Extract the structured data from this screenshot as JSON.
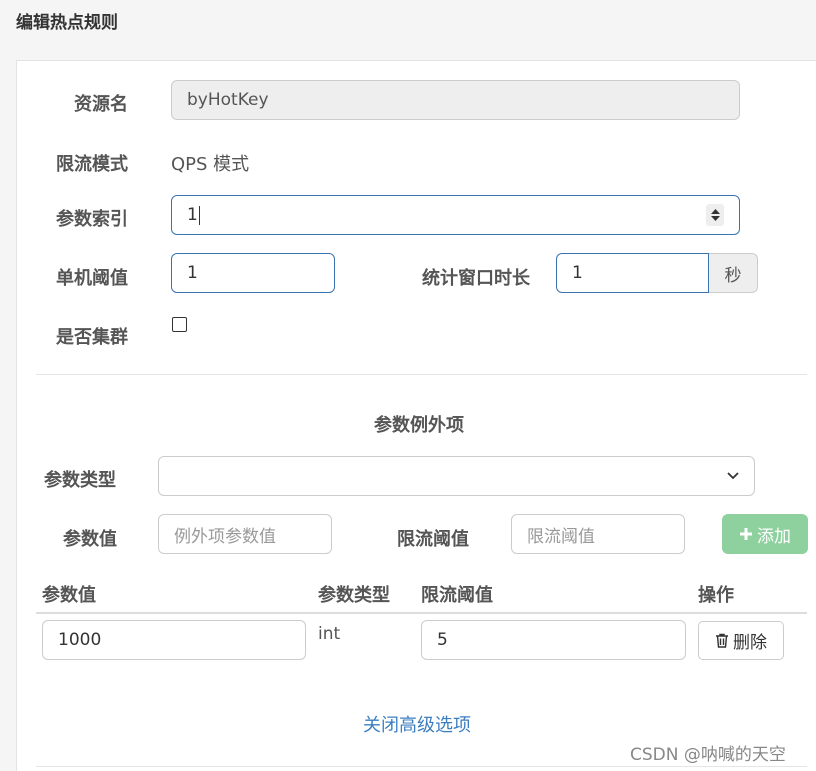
{
  "dialog": {
    "title": "编辑热点规则"
  },
  "form": {
    "resource_label": "资源名",
    "resource_value": "byHotKey",
    "mode_label": "限流模式",
    "mode_value": "QPS 模式",
    "param_index_label": "参数索引",
    "param_index_value": "1",
    "threshold_label": "单机阈值",
    "threshold_value": "1",
    "window_label": "统计窗口时长",
    "window_value": "1",
    "window_unit": "秒",
    "cluster_label": "是否集群",
    "cluster_checked": false
  },
  "exceptions": {
    "heading": "参数例外项",
    "param_type_label": "参数类型",
    "param_type_value": "",
    "param_value_label": "参数值",
    "param_value_placeholder": "例外项参数值",
    "limit_label": "限流阈值",
    "limit_placeholder": "限流阈值",
    "add_button": "添加",
    "table": {
      "headers": [
        "参数值",
        "参数类型",
        "限流阈值",
        "操作"
      ],
      "rows": [
        {
          "param_value": "1000",
          "param_type": "int",
          "limit": "5",
          "action": "删除"
        }
      ]
    }
  },
  "close_advanced_link": "关闭高级选项",
  "watermark": "CSDN @呐喊的天空",
  "icons": {
    "spinner": "number-spinner-icon",
    "dropdown": "chevron-down-icon",
    "add": "plus-icon",
    "delete": "trash-icon"
  },
  "colors": {
    "focus_border": "#3b73b1",
    "add_button_bg": "#8fd19e",
    "link": "#3c7fc0"
  }
}
